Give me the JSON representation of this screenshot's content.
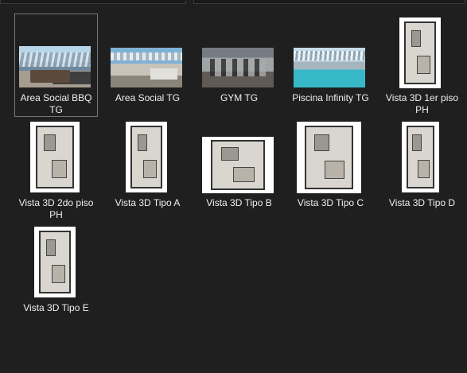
{
  "window": {
    "title": ""
  },
  "items": [
    {
      "id": "area-social-bbq",
      "label": "Area Social BBQ TG",
      "type": "photo",
      "variant": "bbq",
      "selected": true
    },
    {
      "id": "area-social",
      "label": "Area Social TG",
      "type": "photo",
      "variant": "social",
      "selected": false
    },
    {
      "id": "gym",
      "label": "GYM TG",
      "type": "photo",
      "variant": "gym",
      "selected": false
    },
    {
      "id": "piscina",
      "label": "Piscina Infinity TG",
      "type": "photo",
      "variant": "pool",
      "selected": false
    },
    {
      "id": "vista-1er-piso",
      "label": "Vista 3D 1er piso PH",
      "type": "plan",
      "selected": false
    },
    {
      "id": "vista-2do-piso",
      "label": "Vista 3D 2do piso PH",
      "type": "plan",
      "selected": false
    },
    {
      "id": "tipo-a",
      "label": "Vista 3D Tipo A",
      "type": "plan",
      "selected": false
    },
    {
      "id": "tipo-b",
      "label": "Vista 3D Tipo B",
      "type": "plan",
      "selected": false
    },
    {
      "id": "tipo-c",
      "label": "Vista 3D Tipo C",
      "type": "plan",
      "selected": false
    },
    {
      "id": "tipo-d",
      "label": "Vista 3D Tipo D",
      "type": "plan",
      "selected": false
    },
    {
      "id": "tipo-e",
      "label": "Vista 3D Tipo E",
      "type": "plan",
      "selected": false
    }
  ],
  "colors": {
    "background": "#1f1f1f",
    "text": "#f0f0f0",
    "selection_border": "#777777"
  }
}
